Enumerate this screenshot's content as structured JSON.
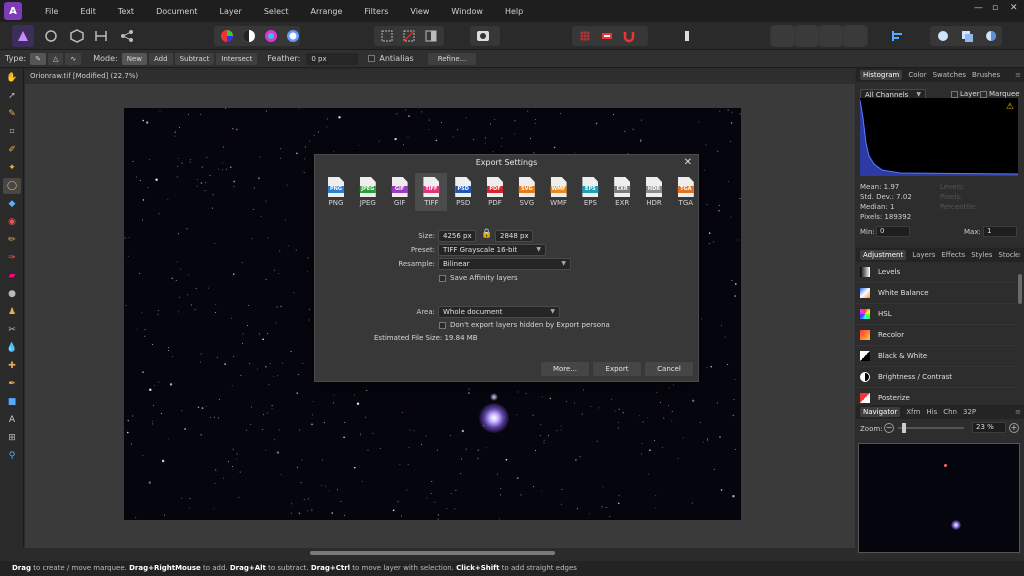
{
  "menu": {
    "items": [
      "File",
      "Edit",
      "Text",
      "Document",
      "Layer",
      "Select",
      "Arrange",
      "Filters",
      "View",
      "Window",
      "Help"
    ],
    "win_minimize": "—",
    "win_restore": "▫",
    "win_close": "✕"
  },
  "context_toolbar": {
    "type_label": "Type:",
    "mode_label": "Mode:",
    "modes": [
      "New",
      "Add",
      "Subtract",
      "Intersect"
    ],
    "feather_label": "Feather:",
    "feather_value": "0 px",
    "antialias_label": "Antialias",
    "refine_label": "Refine..."
  },
  "document": {
    "tab_title": "Orionraw.tif [Modified] (22.7%)"
  },
  "export_dialog": {
    "title": "Export Settings",
    "formats": [
      {
        "label": "PNG",
        "color": "#2b7fd6"
      },
      {
        "label": "JPEG",
        "color": "#2e9b3a"
      },
      {
        "label": "GIF",
        "color": "#9b3dba"
      },
      {
        "label": "TIFF",
        "color": "#e0347a"
      },
      {
        "label": "PSD",
        "color": "#1f57b8"
      },
      {
        "label": "PDF",
        "color": "#d3242a"
      },
      {
        "label": "SVG",
        "color": "#e57a18"
      },
      {
        "label": "WMF",
        "color": "#e78a1d"
      },
      {
        "label": "EPS",
        "color": "#1aa1b5"
      },
      {
        "label": "EXR",
        "color": "#7a7a7a"
      },
      {
        "label": "HDR",
        "color": "#8a8a8a"
      },
      {
        "label": "TGA",
        "color": "#e2731c"
      }
    ],
    "active_format": "TIFF",
    "size_label": "Size:",
    "width": "4256 px",
    "height": "2848 px",
    "preset_label": "Preset:",
    "preset_value": "TIFF Grayscale 16-bit",
    "resample_label": "Resample:",
    "resample_value": "Bilinear",
    "save_layers_label": "Save Affinity layers",
    "area_label": "Area:",
    "area_value": "Whole document",
    "hidden_layers_label": "Don't export layers hidden by Export persona",
    "estimated_size": "Estimated File Size: 19.84 MB",
    "more_label": "More...",
    "export_label": "Export",
    "cancel_label": "Cancel"
  },
  "histogram_panel": {
    "tabs": [
      "Histogram",
      "Color",
      "Swatches",
      "Brushes"
    ],
    "channel": "All Channels",
    "layer_label": "Layer",
    "marquee_label": "Marquee",
    "mean": "Mean: 1.97",
    "std_dev": "Std. Dev.: 7.02",
    "median": "Median: 1",
    "pixels": "Pixels: 189392",
    "levels": "Levels:",
    "pixels_r": "Pixels:",
    "percentile": "Percentile:",
    "min_label": "Min:",
    "min_value": "0",
    "max_label": "Max:",
    "max_value": "1"
  },
  "adjustment_panel": {
    "tabs": [
      "Adjustment",
      "Layers",
      "Effects",
      "Styles",
      "Stock"
    ],
    "items": [
      "Levels",
      "White Balance",
      "HSL",
      "Recolor",
      "Black & White",
      "Brightness / Contrast",
      "Posterize"
    ]
  },
  "navigator_panel": {
    "tabs": [
      "Navigator",
      "Xfm",
      "His",
      "Chn",
      "32P"
    ],
    "zoom_label": "Zoom:",
    "zoom_value": "23 %"
  },
  "status": {
    "p1": "Drag",
    "t1": " to create / move marquee. ",
    "p2": "Drag+RightMouse",
    "t2": " to add. ",
    "p3": "Drag+Alt",
    "t3": " to subtract. ",
    "p4": "Drag+Ctrl",
    "t4": " to move layer with selection. ",
    "p5": "Click+Shift",
    "t5": " to add straight edges"
  }
}
